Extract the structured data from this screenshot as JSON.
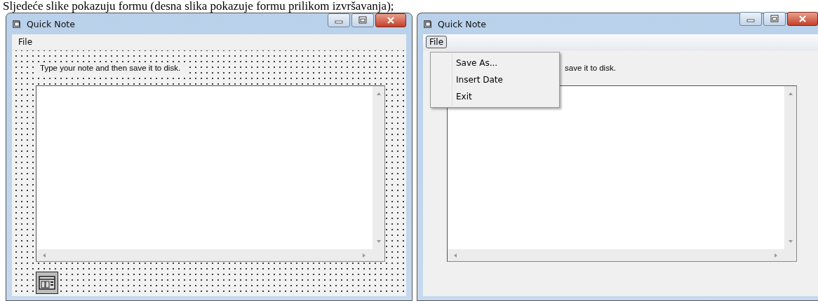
{
  "caption": "Sljedeće slike pokazuju formu (desna slika pokazuje formu prilikom izvršavanja);",
  "windows": [
    {
      "title": "Quick Note",
      "grid": true,
      "menu": [
        {
          "label": "File",
          "selected": false
        }
      ],
      "label": "Type your note and then save it to disk.",
      "timer": true
    },
    {
      "title": "Quick Note",
      "grid": false,
      "menu": [
        {
          "label": "File",
          "selected": true
        }
      ],
      "dropdown": [
        "Save As...",
        "Insert Date",
        "Exit"
      ],
      "label": "save it to disk.",
      "timer": false
    }
  ]
}
